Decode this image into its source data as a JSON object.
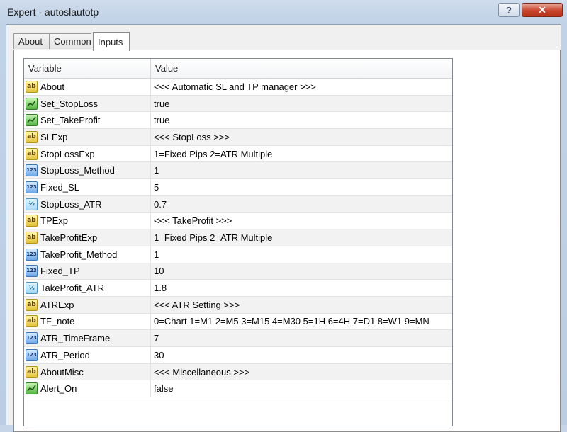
{
  "window": {
    "title": "Expert - autoslautotp",
    "help_label": "?",
    "close_label": "✕"
  },
  "tabs": [
    {
      "label": "About"
    },
    {
      "label": "Common"
    },
    {
      "label": "Inputs"
    }
  ],
  "table": {
    "headers": {
      "variable": "Variable",
      "value": "Value"
    },
    "rows": [
      {
        "type": "string",
        "icon": "ab-icon",
        "icon_text": "ab",
        "name": "About",
        "value": "<<< Automatic SL and TP manager >>>"
      },
      {
        "type": "bool",
        "icon": "bool-icon",
        "icon_text": "",
        "name": "Set_StopLoss",
        "value": "true"
      },
      {
        "type": "bool",
        "icon": "bool-icon",
        "icon_text": "",
        "name": "Set_TakeProfit",
        "value": "true"
      },
      {
        "type": "string",
        "icon": "ab-icon",
        "icon_text": "ab",
        "name": "SLExp",
        "value": "<<< StopLoss >>>"
      },
      {
        "type": "string",
        "icon": "ab-icon",
        "icon_text": "ab",
        "name": "StopLossExp",
        "value": "1=Fixed Pips  2=ATR Multiple"
      },
      {
        "type": "int",
        "icon": "int-icon",
        "icon_text": "123",
        "name": "StopLoss_Method",
        "value": "1"
      },
      {
        "type": "int",
        "icon": "int-icon",
        "icon_text": "123",
        "name": "Fixed_SL",
        "value": "5"
      },
      {
        "type": "double",
        "icon": "double-icon",
        "icon_text": "½",
        "name": "StopLoss_ATR",
        "value": "0.7"
      },
      {
        "type": "string",
        "icon": "ab-icon",
        "icon_text": "ab",
        "name": "TPExp",
        "value": "<<< TakeProfit >>>"
      },
      {
        "type": "string",
        "icon": "ab-icon",
        "icon_text": "ab",
        "name": "TakeProfitExp",
        "value": "1=Fixed Pips  2=ATR Multiple"
      },
      {
        "type": "int",
        "icon": "int-icon",
        "icon_text": "123",
        "name": "TakeProfit_Method",
        "value": "1"
      },
      {
        "type": "int",
        "icon": "int-icon",
        "icon_text": "123",
        "name": "Fixed_TP",
        "value": "10"
      },
      {
        "type": "double",
        "icon": "double-icon",
        "icon_text": "½",
        "name": "TakeProfit_ATR",
        "value": "1.8"
      },
      {
        "type": "string",
        "icon": "ab-icon",
        "icon_text": "ab",
        "name": "ATRExp",
        "value": "<<< ATR Setting >>>"
      },
      {
        "type": "string",
        "icon": "ab-icon",
        "icon_text": "ab",
        "name": "TF_note",
        "value": "0=Chart 1=M1 2=M5 3=M15 4=M30 5=1H 6=4H 7=D1 8=W1 9=MN"
      },
      {
        "type": "int",
        "icon": "int-icon",
        "icon_text": "123",
        "name": "ATR_TimeFrame",
        "value": "7"
      },
      {
        "type": "int",
        "icon": "int-icon",
        "icon_text": "123",
        "name": "ATR_Period",
        "value": "30"
      },
      {
        "type": "string",
        "icon": "ab-icon",
        "icon_text": "ab",
        "name": "AboutMisc",
        "value": "<<< Miscellaneous >>>"
      },
      {
        "type": "bool",
        "icon": "bool-icon",
        "icon_text": "",
        "name": "Alert_On",
        "value": "false"
      }
    ]
  }
}
